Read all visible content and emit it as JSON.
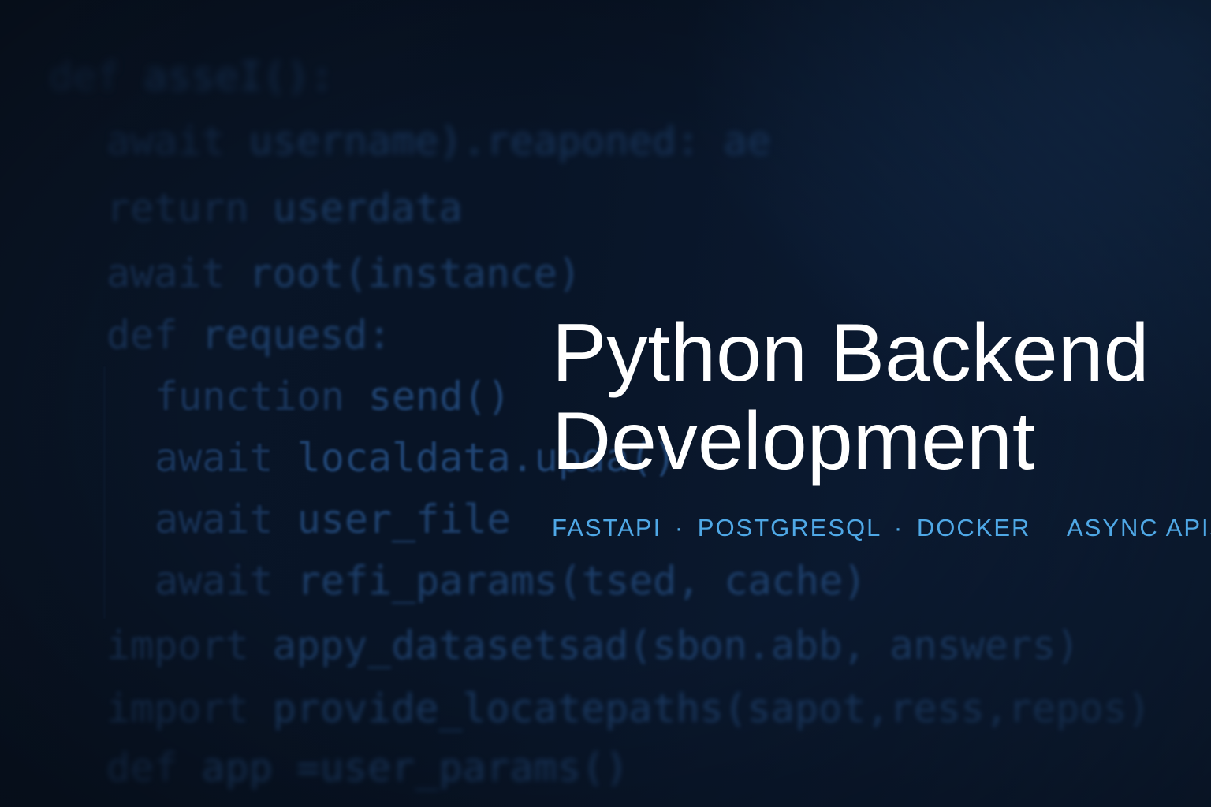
{
  "background": {
    "accent_color": "#4fa8e6",
    "base_color": "#071020",
    "code_lines": [
      {
        "kw": "def",
        "rest": "asseI():"
      },
      {
        "kw": "await",
        "rest": "username).reaponed: ae"
      },
      {
        "kw": "return",
        "rest": "userdata"
      },
      {
        "kw": "await",
        "rest": "root(instance)"
      },
      {
        "kw": "def",
        "rest": "requesd:"
      },
      {
        "kw": "function",
        "rest": "send()"
      },
      {
        "kw": "await",
        "rest": "localdata.upda()"
      },
      {
        "kw": "await",
        "rest": "user_file"
      },
      {
        "kw": "await",
        "rest": "refi_params(tsed, cache)"
      },
      {
        "kw": "import",
        "rest": "appy_datasetsad(sbon.abb, answers)"
      },
      {
        "kw": "import",
        "rest": "provide_locatepaths(sapot,ress,repos)"
      },
      {
        "kw": "def",
        "rest": "app =user_params()"
      }
    ]
  },
  "hero": {
    "title_line1": "Python Backend",
    "title_line2": "Development",
    "tags": [
      "FASTAPI",
      "POSTGRESQL",
      "DOCKER",
      "ASYNC APIs"
    ],
    "separator": "·"
  }
}
